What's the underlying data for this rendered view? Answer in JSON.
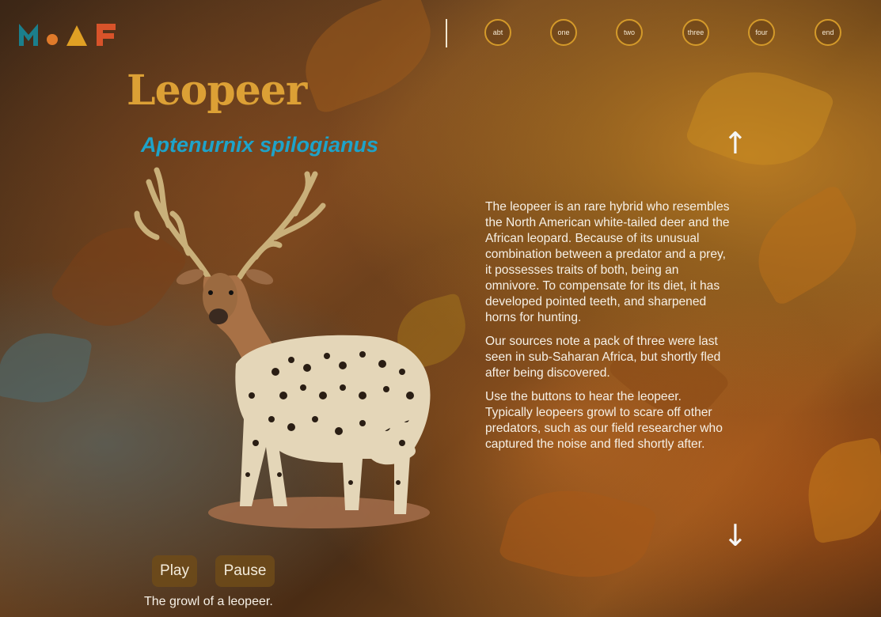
{
  "logo": {
    "text": "MoAF"
  },
  "nav": {
    "items": [
      "abt",
      "one",
      "two",
      "three",
      "four",
      "end"
    ]
  },
  "animal": {
    "name": "Leopeer",
    "scientific_name": "Aptenurnix spilogianus"
  },
  "description": [
    "The leopeer is an rare hybrid who resembles the North American white-tailed deer and the African leopard. Because of its unusual combination between a predator and a prey, it possesses traits of both, being an omnivore. To compensate for its diet, it has developed pointed teeth, and sharpened horns for hunting.",
    "Our sources note a pack of three were last seen in sub-Saharan Africa, but shortly fled after being discovered.",
    "Use the buttons to hear the leopeer. Typically leopeers growl to scare off other predators, such as our field researcher who captured the noise and fled shortly after."
  ],
  "controls": {
    "play_label": "Play",
    "pause_label": "Pause"
  },
  "caption": "The growl of a leopeer.",
  "icons": {
    "up": "arrow-up-icon",
    "down": "arrow-down-icon"
  },
  "colors": {
    "title": "#dca035",
    "subtitle": "#1ea3c9",
    "nav_ring": "#d49a2a",
    "logo_teal": "#1b7f8c",
    "logo_orange": "#e07a2a",
    "logo_gold": "#e0a024",
    "logo_red": "#d8532a"
  }
}
